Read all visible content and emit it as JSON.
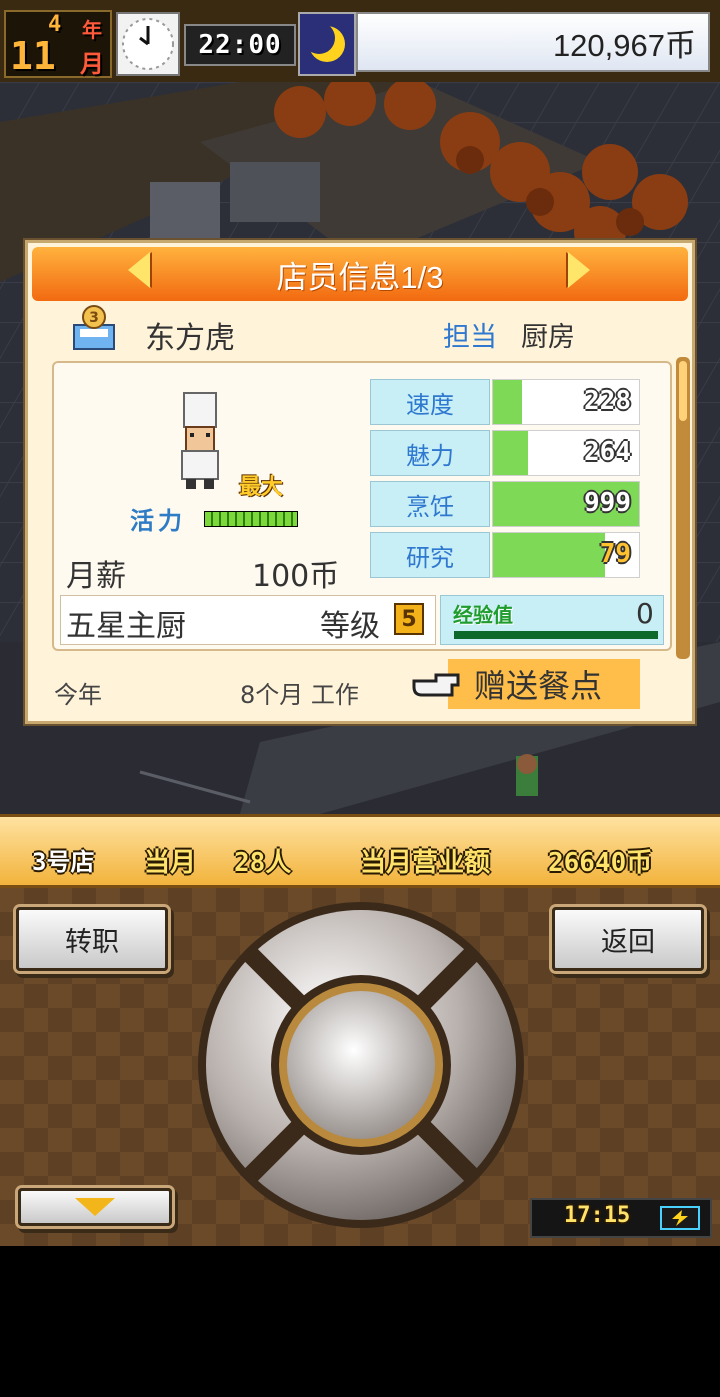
{
  "hud": {
    "year_num": "4",
    "year_unit": "年",
    "month_num": "11",
    "month_unit": "月",
    "time": "22:00",
    "money": "120,967币"
  },
  "panel": {
    "title": "店员信息1/3",
    "name": "东方虎",
    "role_label": "担当",
    "role_value": "厨房",
    "vitality_label": "活力",
    "vitality_status": "最大",
    "vitality_level": 1.0,
    "salary_label": "月薪",
    "salary_value": "100币",
    "rank_title": "五星主厨",
    "level_label": "等级",
    "level_value": "5",
    "exp_label": "经验值",
    "exp_value": "0",
    "stats": [
      {
        "label": "速度",
        "value": "228",
        "fill": 0.2
      },
      {
        "label": "魅力",
        "value": "264",
        "fill": 0.24
      },
      {
        "label": "烹饪",
        "value": "999",
        "fill": 1.0
      },
      {
        "label": "研究",
        "value": "79",
        "fill": 0.77
      }
    ],
    "tenure_year_label": "今年",
    "tenure_text": "8个月 工作",
    "gift_button": "赠送餐点"
  },
  "store_bar": {
    "store_name": "3号店",
    "this_month": "当月",
    "customers": "28人",
    "sales_label": "当月营业额",
    "sales_value": "26640币"
  },
  "controls": {
    "transfer": "转职",
    "back": "返回",
    "battery_time": "17:15"
  },
  "colors": {
    "title_bar": "#f26a10",
    "stat_fill": "#7ed957",
    "panel_bg": "#fff3da"
  }
}
